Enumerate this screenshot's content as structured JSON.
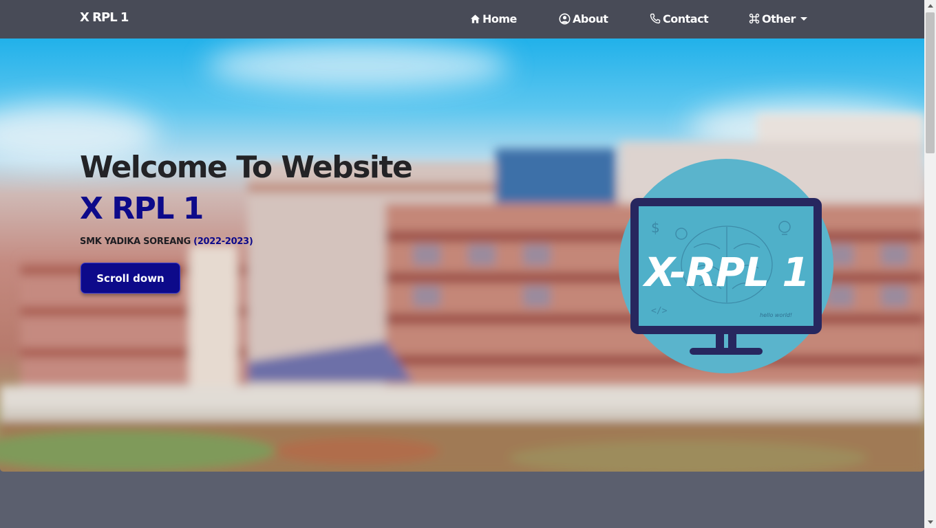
{
  "nav": {
    "brand": "X RPL 1",
    "items": [
      {
        "label": "Home",
        "icon": "house-icon"
      },
      {
        "label": "About",
        "icon": "user-circle-icon"
      },
      {
        "label": "Contact",
        "icon": "phone-icon"
      },
      {
        "label": "Other",
        "icon": "command-icon"
      }
    ]
  },
  "hero": {
    "title_line1": "Welcome To Website",
    "title_line2": "X RPL 1",
    "school": "SMK YADIKA SOREANG",
    "years": "(2022-2023)",
    "button_label": "Scroll down"
  },
  "logo": {
    "text": "X-RPL 1",
    "caption": "hello world!"
  },
  "colors": {
    "navbar": "#484b57",
    "accent_navy": "#0d0a8a",
    "page_bg": "#5b5f6e",
    "logo_circle": "#5ab4cc",
    "monitor": "#27275f"
  }
}
